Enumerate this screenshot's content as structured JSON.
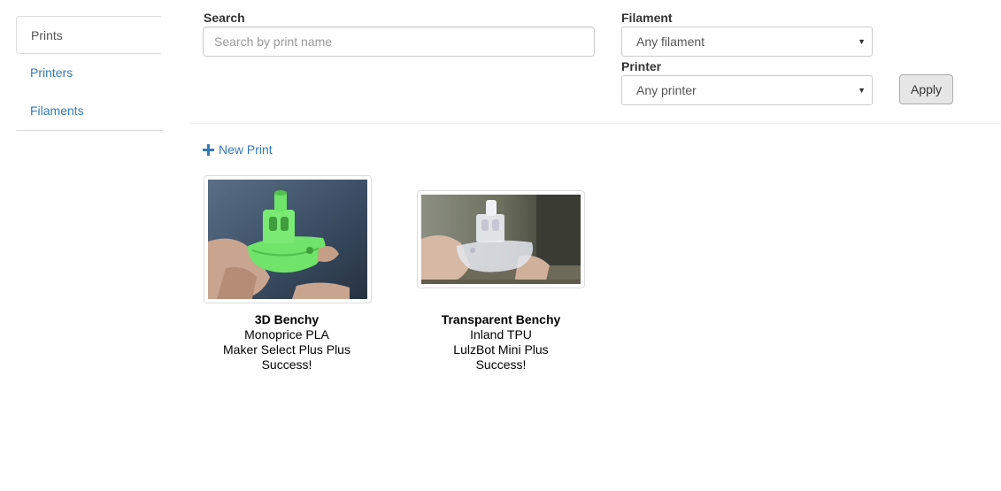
{
  "sidebar": {
    "items": [
      {
        "label": "Prints",
        "active": true
      },
      {
        "label": "Printers",
        "active": false
      },
      {
        "label": "Filaments",
        "active": false
      }
    ]
  },
  "filters": {
    "search_label": "Search",
    "search_placeholder": "Search by print name",
    "search_value": "",
    "filament_label": "Filament",
    "filament_value": "Any filament",
    "printer_label": "Printer",
    "printer_value": "Any printer",
    "apply_label": "Apply"
  },
  "new_print_label": "New Print",
  "prints": [
    {
      "name": "3D Benchy",
      "filament": "Monoprice PLA",
      "printer": "Maker Select Plus Plus",
      "result": "Success!",
      "photo": "green-benchy-photo"
    },
    {
      "name": "Transparent Benchy",
      "filament": "Inland TPU",
      "printer": "LulzBot Mini Plus",
      "result": "Success!",
      "photo": "clear-benchy-photo"
    }
  ],
  "colors": {
    "link": "#337ab7",
    "border": "#dddddd"
  }
}
